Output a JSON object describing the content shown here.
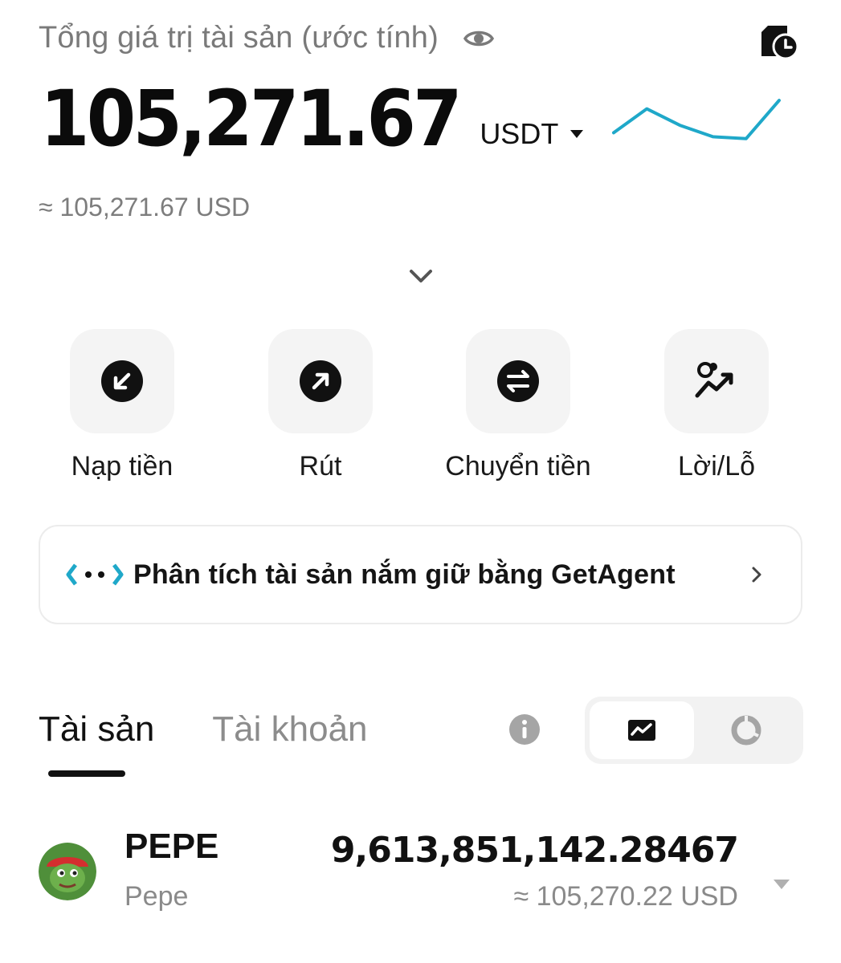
{
  "header": {
    "title": "Tổng giá trị tài sản (ước tính)",
    "eye_icon": "eye-icon",
    "history_icon": "history-clock-icon"
  },
  "balance": {
    "value": "105,271.67",
    "currency": "USDT",
    "approx": "≈ 105,271.67 USD"
  },
  "sparkline": {
    "color": "#1fa8c9",
    "values": [
      0.3,
      0.78,
      0.45,
      0.22,
      0.18,
      0.95
    ]
  },
  "actions": [
    {
      "label": "Nạp tiền",
      "icon": "deposit-icon"
    },
    {
      "label": "Rút",
      "icon": "withdraw-icon"
    },
    {
      "label": "Chuyển tiền",
      "icon": "transfer-icon"
    },
    {
      "label": "Lời/Lỗ",
      "icon": "profit-loss-icon"
    }
  ],
  "agent_banner": {
    "text": "Phân tích tài sản nắm giữ bằng GetAgent",
    "accent": "#1fa8c9"
  },
  "tabs": {
    "assets": "Tài sản",
    "accounts": "Tài khoản"
  },
  "view_toggle": {
    "selected": "trend-view"
  },
  "assets_list": [
    {
      "symbol": "PEPE",
      "name": "Pepe",
      "amount": "9,613,851,142.28467",
      "usd": "≈ 105,270.22 USD"
    }
  ]
}
